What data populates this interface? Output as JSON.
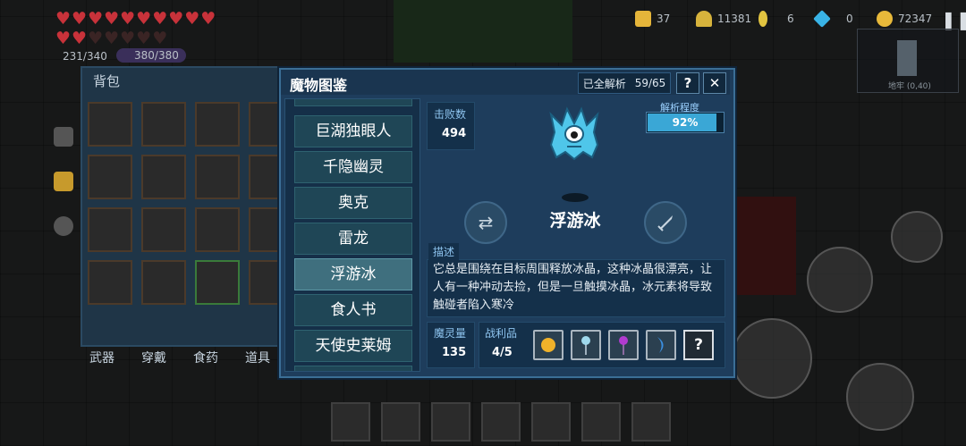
{
  "hud": {
    "hp": "231/340",
    "shield": "380/380",
    "stats": [
      {
        "icon": "badge-icon",
        "value": "37",
        "color": "#e5b53a"
      },
      {
        "icon": "helmet-icon",
        "value": "11381",
        "color": "#d7b33c"
      },
      {
        "icon": "key-icon",
        "value": "6",
        "color": "#e2c440"
      },
      {
        "icon": "gem-icon",
        "value": "0",
        "color": "#39b3e6"
      },
      {
        "icon": "coin-icon",
        "value": "72347",
        "color": "#e8b93a"
      }
    ],
    "minimap_caption": "地牢 (0,40)"
  },
  "backpack": {
    "title": "背包",
    "tabs": [
      "武器",
      "穿戴",
      "食药",
      "道具"
    ]
  },
  "dialog": {
    "title": "魔物图鉴",
    "analyzed_label": "已全解析",
    "analyzed_count": "59/65",
    "help_label": "?",
    "close_label": "✕",
    "monster_list": [
      "巨湖独眼人",
      "千隐幽灵",
      "奥克",
      "雷龙",
      "浮游冰",
      "食人书",
      "天使史莱姆"
    ],
    "selected_index": 4,
    "kills_label": "击败数",
    "kills_value": "494",
    "analysis_label": "解析程度",
    "analysis_value": "92%",
    "analysis_fraction": 0.92,
    "monster_name": "浮游冰",
    "desc_label": "描述",
    "desc_text": "它总是围绕在目标周围释放冰晶，这种冰晶很漂亮，让人有一种冲动去捡，但是一旦触摸冰晶，冰元素将导致触碰者陷入寒冷",
    "soul_label": "魔灵量",
    "soul_value": "135",
    "loot_label": "战利品",
    "loot_value": "4/5",
    "loot_items": [
      {
        "icon": "gold-coin-icon",
        "color": "#f0b22a"
      },
      {
        "icon": "ice-wand-icon",
        "color": "#9fd8ec"
      },
      {
        "icon": "purple-staff-icon",
        "color": "#b13bd0"
      },
      {
        "icon": "crescent-blade-icon",
        "color": "#3a8fe0"
      }
    ],
    "loot_unknown": "?"
  }
}
